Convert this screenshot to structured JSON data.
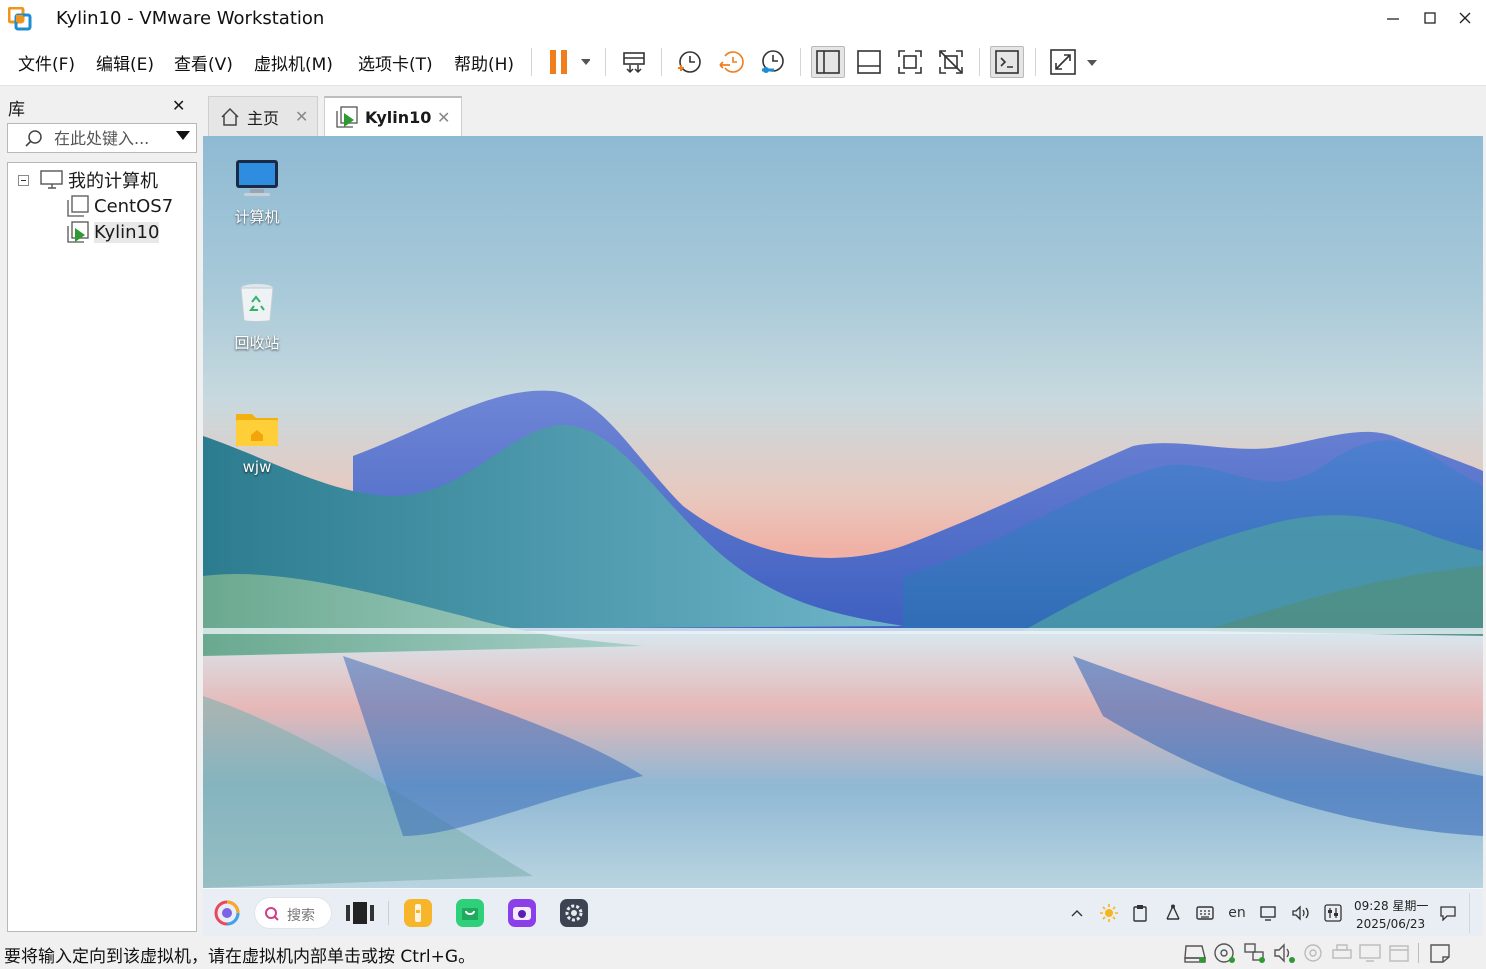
{
  "window": {
    "title": "Kylin10 - VMware Workstation",
    "minimize": "—",
    "maximize": "☐",
    "close": "✕"
  },
  "menu": {
    "items": [
      "文件(F)",
      "编辑(E)",
      "查看(V)",
      "虚拟机(M)",
      "选项卡(T)",
      "帮助(H)"
    ]
  },
  "toolbar": {
    "icons": [
      "pause-icon",
      "send-ctrl-alt-del-icon",
      "take-snapshot-icon",
      "revert-snapshot-icon",
      "snapshot-manager-icon",
      "show-library-icon",
      "thumbnail-bar-icon",
      "full-screen-icon",
      "unity-icon",
      "console-view-icon",
      "stretch-guest-icon"
    ],
    "accent": "#f07d1e"
  },
  "library": {
    "title": "库",
    "close": "✕",
    "search_placeholder": "在此处键入...",
    "tree": {
      "root": "我的计算机",
      "children": [
        "CentOS7",
        "Kylin10"
      ],
      "selected": "Kylin10"
    }
  },
  "tabs": [
    {
      "label": "主页",
      "close": "✕",
      "icon": "home-icon"
    },
    {
      "label": "Kylin10",
      "close": "✕",
      "icon": "vm-running-icon",
      "active": true
    }
  ],
  "desktop": {
    "icons": [
      {
        "label": "计算机",
        "icon": "computer-icon"
      },
      {
        "label": "回收站",
        "icon": "trash-icon"
      },
      {
        "label": "wjw",
        "icon": "home-folder-icon"
      }
    ]
  },
  "taskbar": {
    "search_label": "搜索",
    "apps": [
      "start-menu-icon",
      "multitask-view-icon",
      "file-manager-icon",
      "software-store-icon",
      "screenshot-icon",
      "settings-icon"
    ],
    "tray": {
      "lang": "en",
      "time": "09:28 星期一",
      "date": "2025/06/23"
    }
  },
  "status": {
    "message": "要将输入定向到该虚拟机，请在虚拟机内部单击或按 Ctrl+G。"
  }
}
